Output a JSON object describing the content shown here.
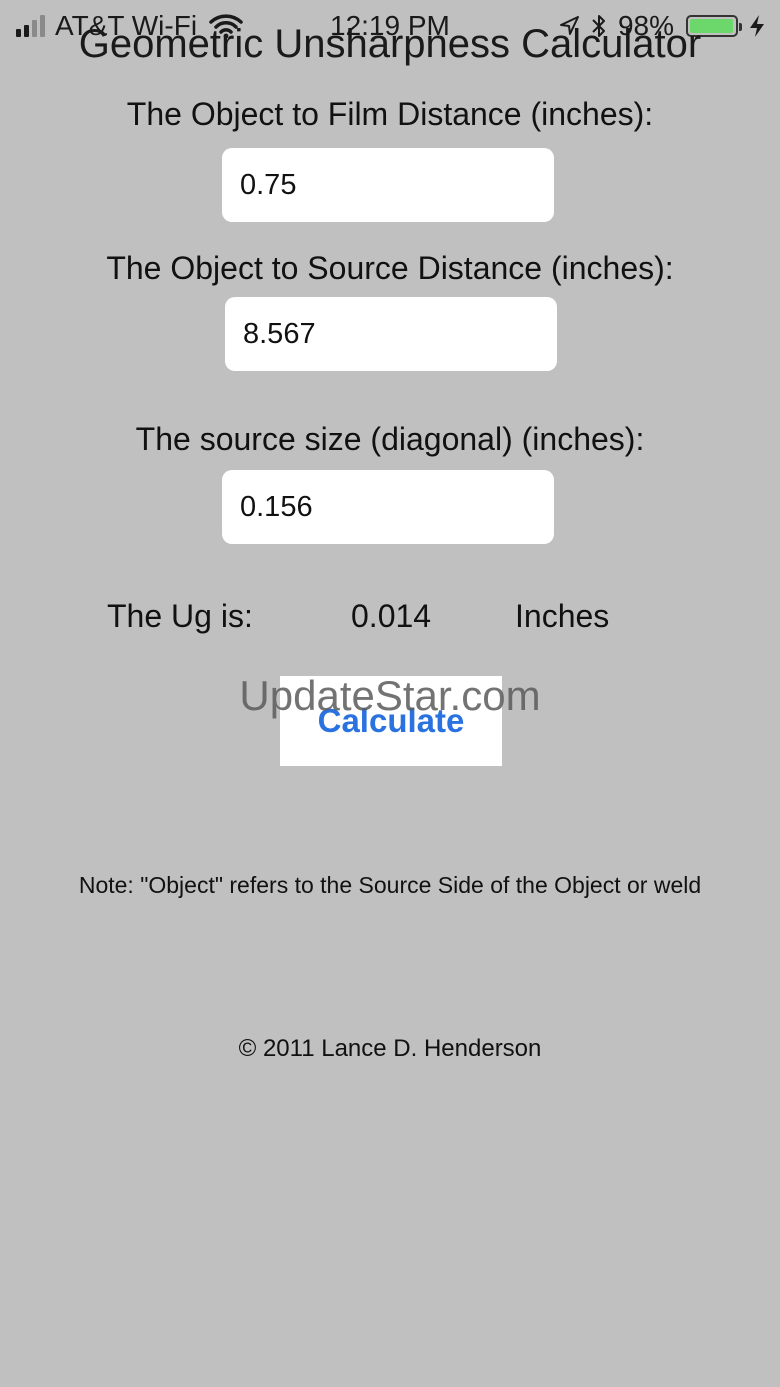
{
  "status_bar": {
    "carrier": "AT&T Wi-Fi",
    "time": "12:19 PM",
    "battery_percent": "98%",
    "battery_level": 0.98,
    "battery_color": "#6cd86c"
  },
  "app": {
    "title": "Geometric Unsharpness Calculator"
  },
  "form": {
    "film_distance_label": "The Object to Film Distance (inches):",
    "film_distance_value": "0.75",
    "source_distance_label": "The Object to Source Distance (inches):",
    "source_distance_value": "8.567",
    "source_size_label": "The source size (diagonal) (inches):",
    "source_size_value": "0.156"
  },
  "result": {
    "label": "The Ug is:",
    "value": "0.014",
    "unit": "Inches"
  },
  "actions": {
    "calculate_label": "Calculate"
  },
  "watermark": "UpdateStar.com",
  "note": "Note: \"Object\" refers to the Source Side of the Object or weld",
  "copyright": "© 2011 Lance D. Henderson",
  "colors": {
    "background": "#c0c0c0",
    "button_text": "#2a72e0"
  }
}
